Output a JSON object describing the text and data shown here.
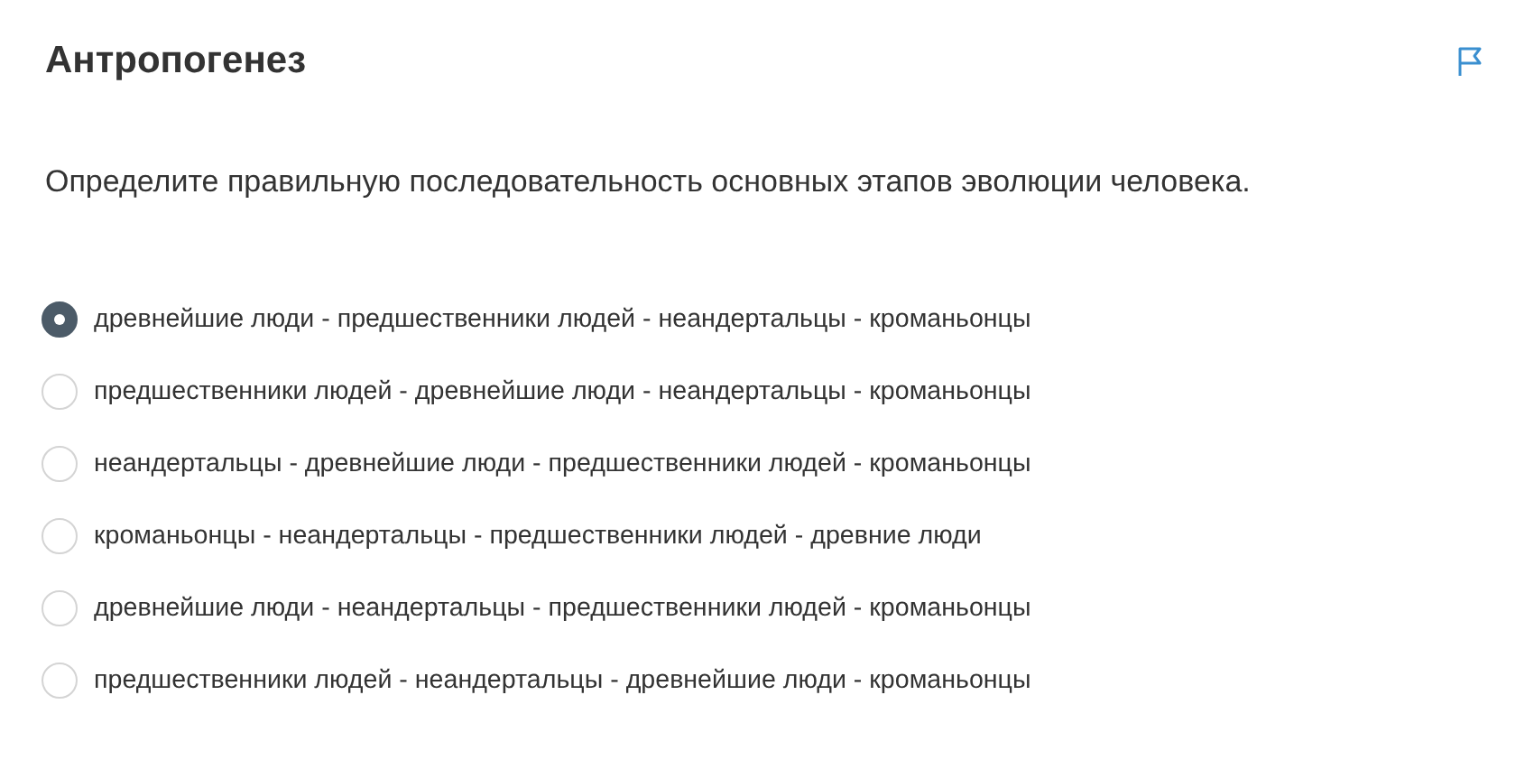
{
  "title": "Антропогенез",
  "question": "Определите правильную последовательность основных этапов эволюции человека.",
  "options": [
    {
      "label": "древнейшие люди - предшественники людей - неандертальцы - кроманьонцы",
      "selected": true
    },
    {
      "label": "предшественники людей - древнейшие люди - неандертальцы - кроманьонцы",
      "selected": false
    },
    {
      "label": "неандертальцы - древнейшие люди - предшественники людей - кроманьонцы",
      "selected": false
    },
    {
      "label": "кроманьонцы - неандертальцы - предшественники людей - древние люди",
      "selected": false
    },
    {
      "label": "древнейшие люди - неандертальцы - предшественники людей - кроманьонцы",
      "selected": false
    },
    {
      "label": "предшественники людей - неандертальцы - древнейшие люди - кроманьонцы",
      "selected": false
    }
  ]
}
